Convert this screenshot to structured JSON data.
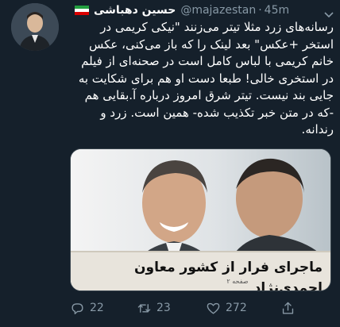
{
  "tweet": {
    "author_name": "حسین دهباشی",
    "handle": "@majazestan",
    "separator": "·",
    "time": "45m",
    "text": "رسانه‌های زرد مثلا تیتر می‌زنند \"نیکی کریمی در استخر +عکس\" بعد لینک را که باز می‌کنی، عکس خانم کریمی با لباس کامل است در صحنه‌ای از فیلم در استخری خالی! طبعا دست او هم برای شکایت به جایی بند نیست. تیتر شرق امروز درباره آ.بقایی هم -که در متن خبر تکذیب شده- همین است. زرد و رندانه.",
    "media": {
      "headline": "ماجرای فرار از کشور معاون احمدی‌نژاد",
      "page_note": "صفحه ۲"
    },
    "actions": {
      "reply_count": "22",
      "retweet_count": "23",
      "like_count": "272"
    }
  },
  "icons": {
    "reply": "reply-icon",
    "retweet": "retweet-icon",
    "like": "heart-icon",
    "share": "share-icon",
    "caret": "chevron-down-icon"
  },
  "colors": {
    "background": "#15202b",
    "secondary_text": "#8899a6",
    "primary_text": "#ffffff",
    "headline_bar": "#e8e4dc"
  }
}
